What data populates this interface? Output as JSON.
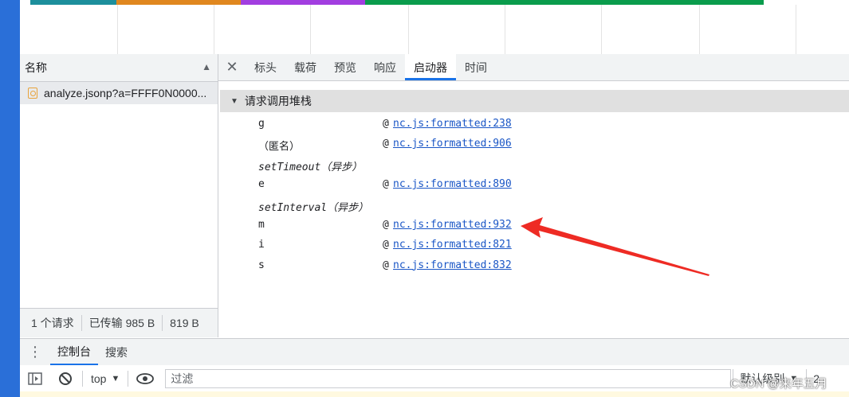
{
  "timeline": {
    "strips": [
      {
        "color": "#1d8f9c"
      },
      {
        "color": "#e0871f"
      },
      {
        "color": "#a23ee0"
      },
      {
        "color": "#0a9c4c"
      }
    ]
  },
  "requests_panel": {
    "header": "名称",
    "sort_icon": "sort-up-triangle-icon",
    "rows": [
      {
        "name": "analyze.jsonp?a=FFFF0N0000..."
      }
    ],
    "status": {
      "count": "1 个请求",
      "transferred": "已传输 985 B",
      "size": "819 B"
    }
  },
  "detail_tabs": {
    "close_icon": "close-icon",
    "tabs": [
      {
        "label": "标头",
        "active": false
      },
      {
        "label": "载荷",
        "active": false
      },
      {
        "label": "预览",
        "active": false
      },
      {
        "label": "响应",
        "active": false
      },
      {
        "label": "启动器",
        "active": true
      },
      {
        "label": "时间",
        "active": false
      }
    ]
  },
  "initiator": {
    "section_title": "请求调用堆栈",
    "frames": [
      {
        "name": "g",
        "at": "@",
        "link": "nc.js:formatted:238"
      },
      {
        "name": "（匿名）",
        "at": "@",
        "link": "nc.js:formatted:906"
      },
      {
        "name": "setTimeout（异步）",
        "async": true
      },
      {
        "name": "e",
        "at": "@",
        "link": "nc.js:formatted:890"
      },
      {
        "name": "setInterval（异步）",
        "async": true
      },
      {
        "name": "m",
        "at": "@",
        "link": "nc.js:formatted:932"
      },
      {
        "name": "i",
        "at": "@",
        "link": "nc.js:formatted:821"
      },
      {
        "name": "s",
        "at": "@",
        "link": "nc.js:formatted:832"
      }
    ],
    "annotation_color": "#ee2b24"
  },
  "drawer": {
    "tabs": [
      {
        "label": "控制台",
        "active": true
      },
      {
        "label": "搜索",
        "active": false
      }
    ]
  },
  "console_toolbar": {
    "context": "top",
    "filter_placeholder": "过滤",
    "level": "默认级别",
    "issues": "2"
  },
  "watermark": "CSDN @来年五月"
}
